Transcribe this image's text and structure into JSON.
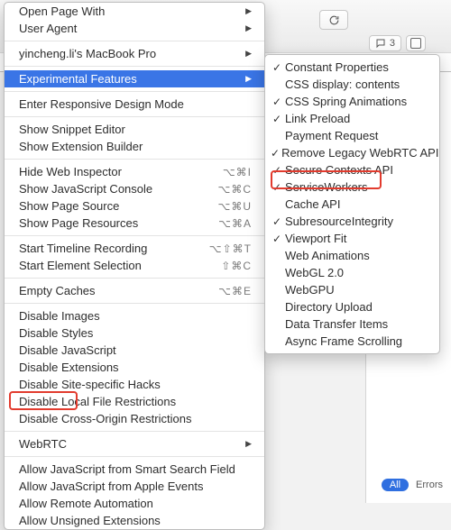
{
  "toolbar": {
    "comment_count": "3"
  },
  "filters": {
    "all": "All",
    "errors": "Errors"
  },
  "menu": {
    "groups": [
      [
        {
          "name": "open-page-with",
          "label": "Open Page With",
          "arrow": true
        },
        {
          "name": "user-agent",
          "label": "User Agent",
          "arrow": true
        }
      ],
      [
        {
          "name": "device",
          "label": "yincheng.li's MacBook Pro",
          "arrow": true
        }
      ],
      [
        {
          "name": "experimental-features",
          "label": "Experimental Features",
          "arrow": true,
          "selected": true
        }
      ],
      [
        {
          "name": "enter-responsive-design-mode",
          "label": "Enter Responsive Design Mode"
        }
      ],
      [
        {
          "name": "show-snippet-editor",
          "label": "Show Snippet Editor"
        },
        {
          "name": "show-extension-builder",
          "label": "Show Extension Builder"
        }
      ],
      [
        {
          "name": "hide-web-inspector",
          "label": "Hide Web Inspector",
          "shortcut": "⌥⌘I"
        },
        {
          "name": "show-javascript-console",
          "label": "Show JavaScript Console",
          "shortcut": "⌥⌘C"
        },
        {
          "name": "show-page-source",
          "label": "Show Page Source",
          "shortcut": "⌥⌘U"
        },
        {
          "name": "show-page-resources",
          "label": "Show Page Resources",
          "shortcut": "⌥⌘A"
        }
      ],
      [
        {
          "name": "start-timeline-recording",
          "label": "Start Timeline Recording",
          "shortcut": "⌥⇧⌘T"
        },
        {
          "name": "start-element-selection",
          "label": "Start Element Selection",
          "shortcut": "⇧⌘C"
        }
      ],
      [
        {
          "name": "empty-caches",
          "label": "Empty Caches",
          "shortcut": "⌥⌘E"
        }
      ],
      [
        {
          "name": "disable-images",
          "label": "Disable Images"
        },
        {
          "name": "disable-styles",
          "label": "Disable Styles"
        },
        {
          "name": "disable-javascript",
          "label": "Disable JavaScript"
        },
        {
          "name": "disable-extensions",
          "label": "Disable Extensions"
        },
        {
          "name": "disable-site-specific-hacks",
          "label": "Disable Site-specific Hacks"
        },
        {
          "name": "disable-local-file-restrictions",
          "label": "Disable Local File Restrictions"
        },
        {
          "name": "disable-cross-origin-restrictions",
          "label": "Disable Cross-Origin Restrictions"
        }
      ],
      [
        {
          "name": "webrtc",
          "label": "WebRTC",
          "arrow": true
        }
      ],
      [
        {
          "name": "allow-js-smart-search",
          "label": "Allow JavaScript from Smart Search Field"
        },
        {
          "name": "allow-js-apple-events",
          "label": "Allow JavaScript from Apple Events"
        },
        {
          "name": "allow-remote-automation",
          "label": "Allow Remote Automation"
        },
        {
          "name": "allow-unsigned-extensions",
          "label": "Allow Unsigned Extensions"
        }
      ]
    ]
  },
  "submenu": {
    "items": [
      {
        "name": "constant-properties",
        "label": "Constant Properties",
        "checked": true
      },
      {
        "name": "css-display-contents",
        "label": "CSS display: contents",
        "checked": false
      },
      {
        "name": "css-spring-animations",
        "label": "CSS Spring Animations",
        "checked": true
      },
      {
        "name": "link-preload",
        "label": "Link Preload",
        "checked": true
      },
      {
        "name": "payment-request",
        "label": "Payment Request",
        "checked": false
      },
      {
        "name": "remove-legacy-webrtc-api",
        "label": "Remove Legacy WebRTC API",
        "checked": true
      },
      {
        "name": "secure-contexts-api",
        "label": "Secure Contexts API",
        "checked": true
      },
      {
        "name": "serviceworkers",
        "label": "ServiceWorkers",
        "checked": true
      },
      {
        "name": "cache-api",
        "label": "Cache API",
        "checked": false
      },
      {
        "name": "subresource-integrity",
        "label": "SubresourceIntegrity",
        "checked": true
      },
      {
        "name": "viewport-fit",
        "label": "Viewport Fit",
        "checked": true
      },
      {
        "name": "web-animations",
        "label": "Web Animations",
        "checked": false
      },
      {
        "name": "webgl-2",
        "label": "WebGL 2.0",
        "checked": false
      },
      {
        "name": "webgpu",
        "label": "WebGPU",
        "checked": false
      },
      {
        "name": "directory-upload",
        "label": "Directory Upload",
        "checked": false
      },
      {
        "name": "data-transfer-items",
        "label": "Data Transfer Items",
        "checked": false
      },
      {
        "name": "async-frame-scrolling",
        "label": "Async Frame Scrolling",
        "checked": false
      }
    ]
  }
}
